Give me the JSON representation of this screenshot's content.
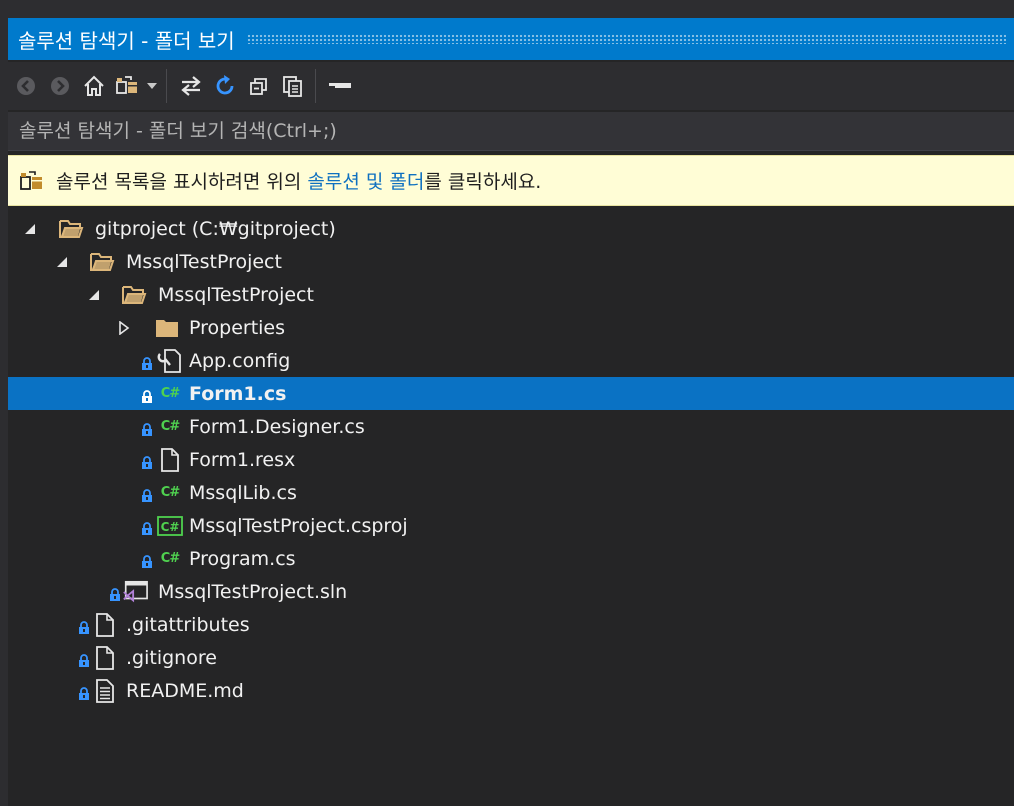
{
  "window": {
    "title": "솔루션 탐색기 - 폴더 보기"
  },
  "toolbar": {
    "buttons": [
      "back-icon",
      "forward-icon",
      "home-icon",
      "switch-views-icon",
      "dropdown-icon",
      "sync-icon",
      "refresh-icon",
      "collapse-all-icon",
      "show-all-files-icon",
      "properties-icon"
    ]
  },
  "search": {
    "placeholder": "솔루션 탐색기 - 폴더 보기 검색(Ctrl+;)"
  },
  "infobar": {
    "text_before": "솔루션 목록을 표시하려면 위의 ",
    "link": "솔루션 및 폴더",
    "text_after": "를 클릭하세요."
  },
  "tree": {
    "rows": [
      {
        "label": "gitproject (C:₩gitproject)",
        "icon": "folder-open-icon",
        "expanded": true
      },
      {
        "label": "MssqlTestProject",
        "icon": "folder-open-icon",
        "expanded": true
      },
      {
        "label": "MssqlTestProject",
        "icon": "folder-open-icon",
        "expanded": true
      },
      {
        "label": "Properties",
        "icon": "folder-icon",
        "expanded": false
      },
      {
        "label": "App.config",
        "icon": "config-file-icon",
        "locked": true
      },
      {
        "label": "Form1.cs",
        "icon": "csharp-icon",
        "locked": true,
        "selected": true
      },
      {
        "label": "Form1.Designer.cs",
        "icon": "csharp-icon",
        "locked": true
      },
      {
        "label": "Form1.resx",
        "icon": "file-icon",
        "locked": true
      },
      {
        "label": "MssqlLib.cs",
        "icon": "csharp-icon",
        "locked": true
      },
      {
        "label": "MssqlTestProject.csproj",
        "icon": "csproj-icon",
        "locked": true
      },
      {
        "label": "Program.cs",
        "icon": "csharp-icon",
        "locked": true
      },
      {
        "label": "MssqlTestProject.sln",
        "icon": "solution-icon",
        "locked": true
      },
      {
        "label": ".gitattributes",
        "icon": "file-icon",
        "locked": true
      },
      {
        "label": ".gitignore",
        "icon": "file-icon",
        "locked": true
      },
      {
        "label": "README.md",
        "icon": "text-file-icon",
        "locked": true
      }
    ]
  },
  "colors": {
    "accent": "#007acc",
    "selection": "#0a72c4",
    "infobar_bg": "#fffdd6",
    "link": "#0e70c0",
    "csharp": "#4fd14f",
    "folder": "#dcb67a"
  }
}
